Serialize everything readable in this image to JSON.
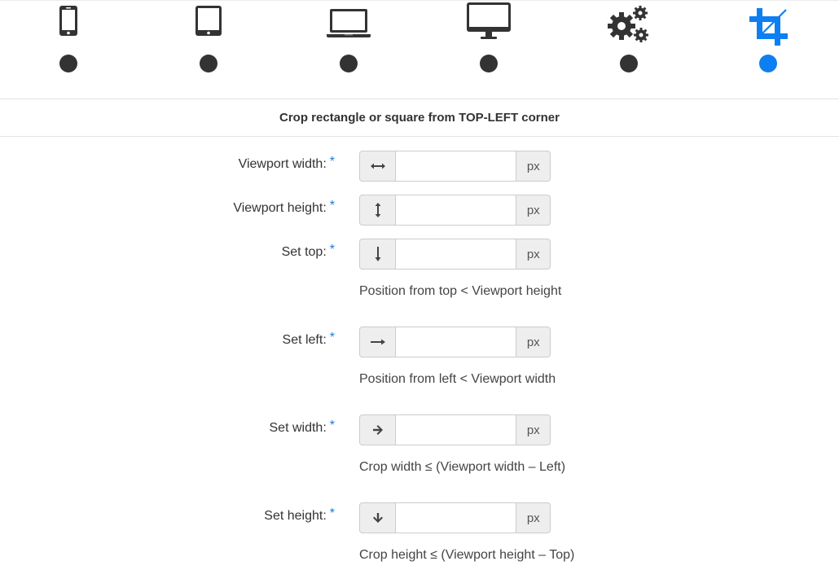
{
  "devices": [
    {
      "name": "smartphone",
      "icon": "smartphone-icon",
      "active": false
    },
    {
      "name": "tablet",
      "icon": "tablet-icon",
      "active": false
    },
    {
      "name": "laptop",
      "icon": "laptop-icon",
      "active": false
    },
    {
      "name": "desktop",
      "icon": "desktop-monitor-icon",
      "active": false
    },
    {
      "name": "custom-settings",
      "icon": "gears-icon",
      "active": false
    },
    {
      "name": "crop",
      "icon": "crop-icon",
      "active": true
    }
  ],
  "colors": {
    "accent": "#0d7ff2",
    "dot_inactive": "#333333",
    "required_star": "#1e78e6"
  },
  "section_title": "Crop rectangle or square from TOP-LEFT corner",
  "fields": {
    "viewport_width": {
      "label": "Viewport width:",
      "required": "*",
      "unit": "px",
      "value": "",
      "icon": "arrows-horizontal-icon"
    },
    "viewport_height": {
      "label": "Viewport height:",
      "required": "*",
      "unit": "px",
      "value": "",
      "icon": "arrows-vertical-icon"
    },
    "set_top": {
      "label": "Set top:",
      "required": "*",
      "unit": "px",
      "value": "",
      "icon": "long-arrow-down-icon",
      "help": "Position from top < Viewport height"
    },
    "set_left": {
      "label": "Set left:",
      "required": "*",
      "unit": "px",
      "value": "",
      "icon": "long-arrow-right-icon",
      "help": "Position from left < Viewport width"
    },
    "set_width": {
      "label": "Set width:",
      "required": "*",
      "unit": "px",
      "value": "",
      "icon": "arrow-right-icon",
      "help": "Crop width ≤ (Viewport width – Left)"
    },
    "set_height": {
      "label": "Set height:",
      "required": "*",
      "unit": "px",
      "value": "",
      "icon": "arrow-down-icon",
      "help": "Crop height ≤ (Viewport height – Top)"
    }
  }
}
